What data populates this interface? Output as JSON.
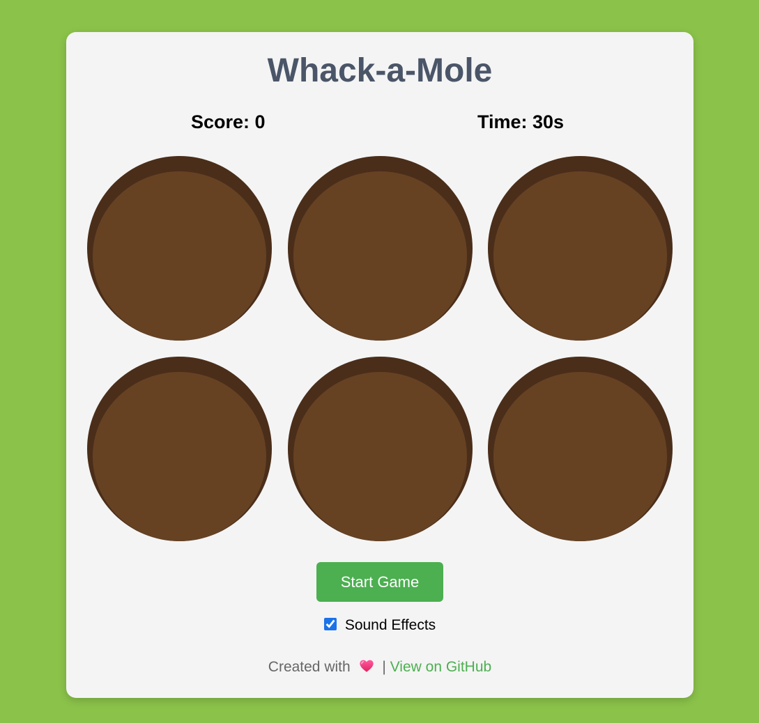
{
  "game": {
    "title": "Whack-a-Mole",
    "score_label": "Score: 0",
    "time_label": "Time: 30s",
    "score": 0,
    "time_seconds": 30
  },
  "holes": [
    {
      "id": 1
    },
    {
      "id": 2
    },
    {
      "id": 3
    },
    {
      "id": 4
    },
    {
      "id": 5
    },
    {
      "id": 6
    }
  ],
  "controls": {
    "start_label": "Start Game",
    "sound_label": "Sound Effects",
    "sound_checked": true
  },
  "footer": {
    "created_with": "Created with",
    "heart_icon": "heart-icon",
    "separator": "|",
    "github_link": "View on GitHub"
  },
  "colors": {
    "background": "#8bc34a",
    "card": "#f4f4f4",
    "title": "#4a5568",
    "hole_rim": "#4a2e1a",
    "hole_dirt": "#664223",
    "button": "#4caf50",
    "link": "#4caf50"
  }
}
